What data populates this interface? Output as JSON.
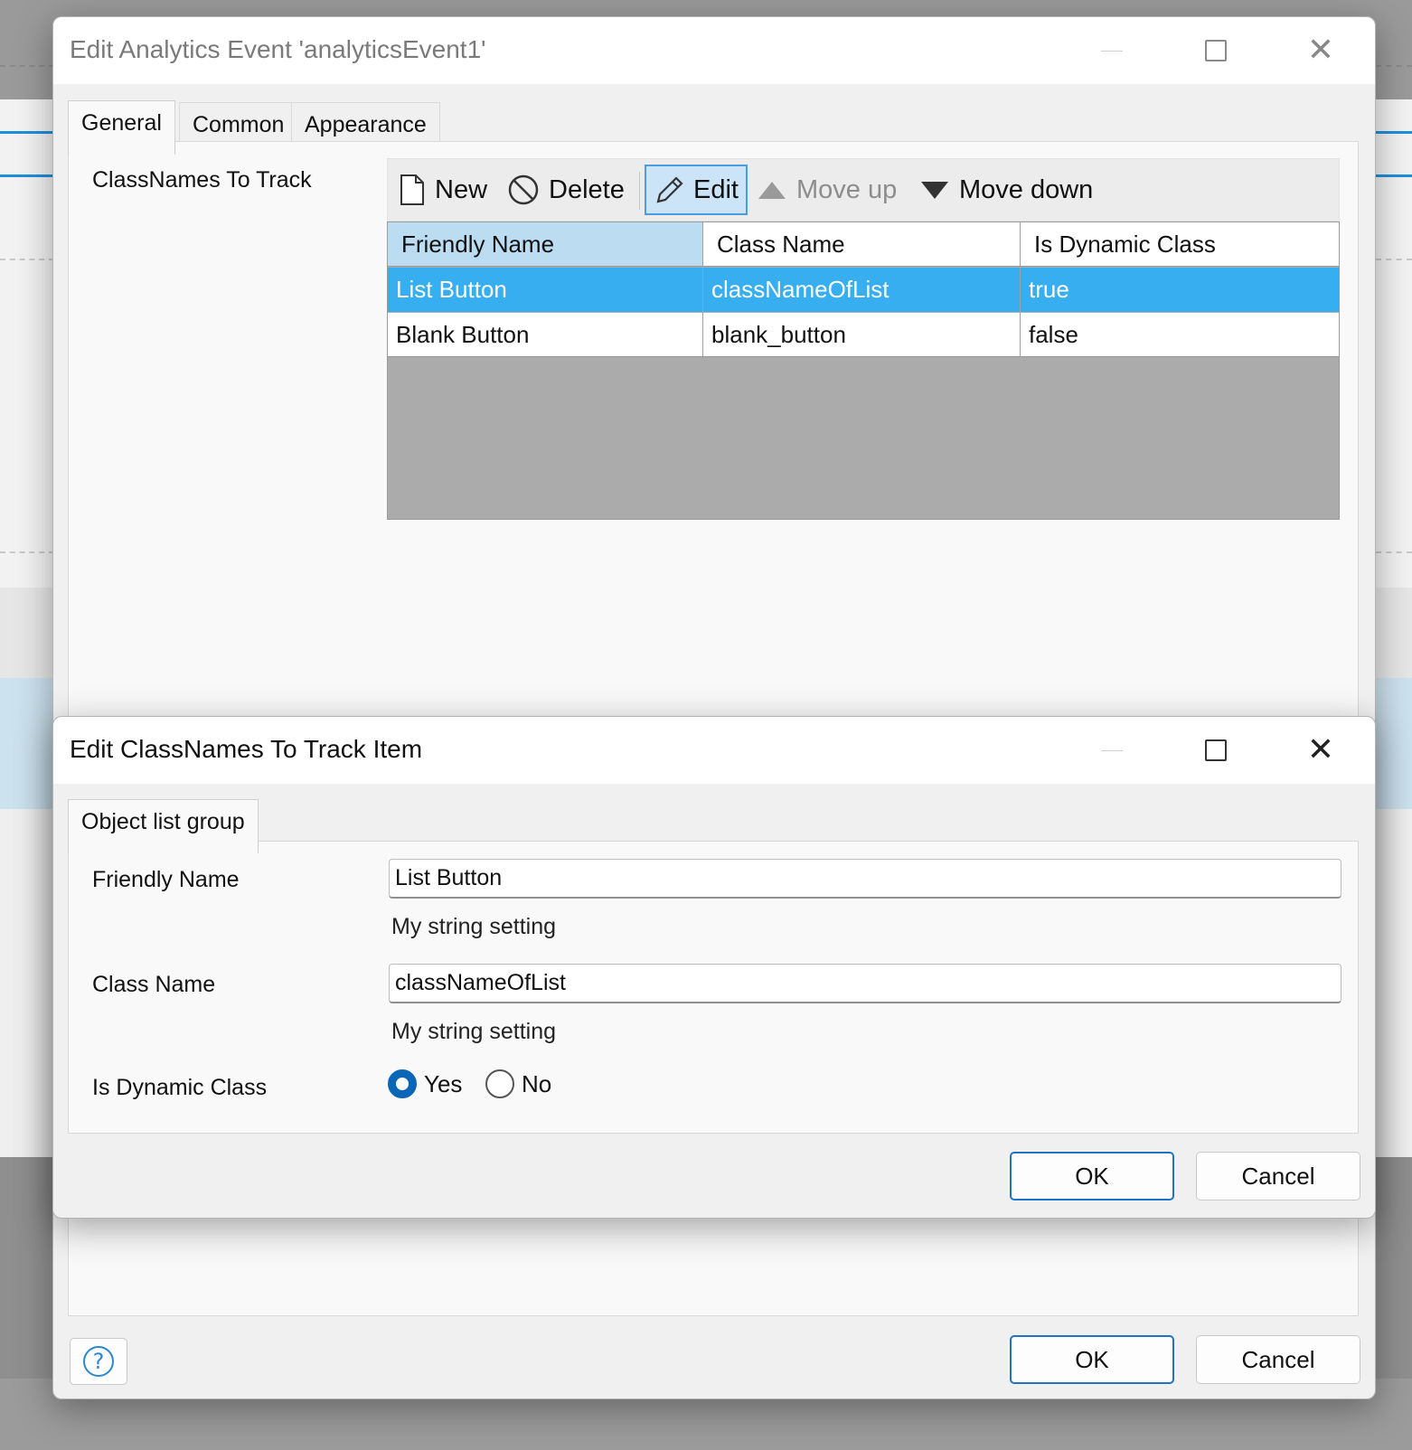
{
  "main_dialog": {
    "title": "Edit Analytics Event 'analyticsEvent1'",
    "tabs": [
      {
        "label": "General"
      },
      {
        "label": "Common"
      },
      {
        "label": "Appearance"
      }
    ],
    "section_label": "ClassNames To Track",
    "toolbar": {
      "new_label": "New",
      "delete_label": "Delete",
      "edit_label": "Edit",
      "move_up_label": "Move up",
      "move_down_label": "Move down"
    },
    "grid": {
      "columns": [
        "Friendly Name",
        "Class Name",
        "Is Dynamic Class"
      ],
      "rows": [
        {
          "friendly_name": "List Button",
          "class_name": "classNameOfList",
          "is_dynamic": "true",
          "selected": true
        },
        {
          "friendly_name": "Blank Button",
          "class_name": "blank_button",
          "is_dynamic": "false",
          "selected": false
        }
      ]
    },
    "ok_label": "OK",
    "cancel_label": "Cancel",
    "help_icon": "question-circle-icon"
  },
  "item_dialog": {
    "title": "Edit ClassNames To Track Item",
    "tab_label": "Object list group",
    "friendly_name": {
      "label": "Friendly Name",
      "value": "List Button",
      "hint": "My string setting"
    },
    "class_name": {
      "label": "Class Name",
      "value": "classNameOfList",
      "hint": "My string setting"
    },
    "is_dynamic": {
      "label": "Is Dynamic Class",
      "yes_label": "Yes",
      "no_label": "No",
      "selected": "Yes"
    },
    "ok_label": "OK",
    "cancel_label": "Cancel"
  },
  "colors": {
    "selection": "#37aeef",
    "accent": "#1f73c2",
    "sorted_header": "#bcdcf2"
  }
}
